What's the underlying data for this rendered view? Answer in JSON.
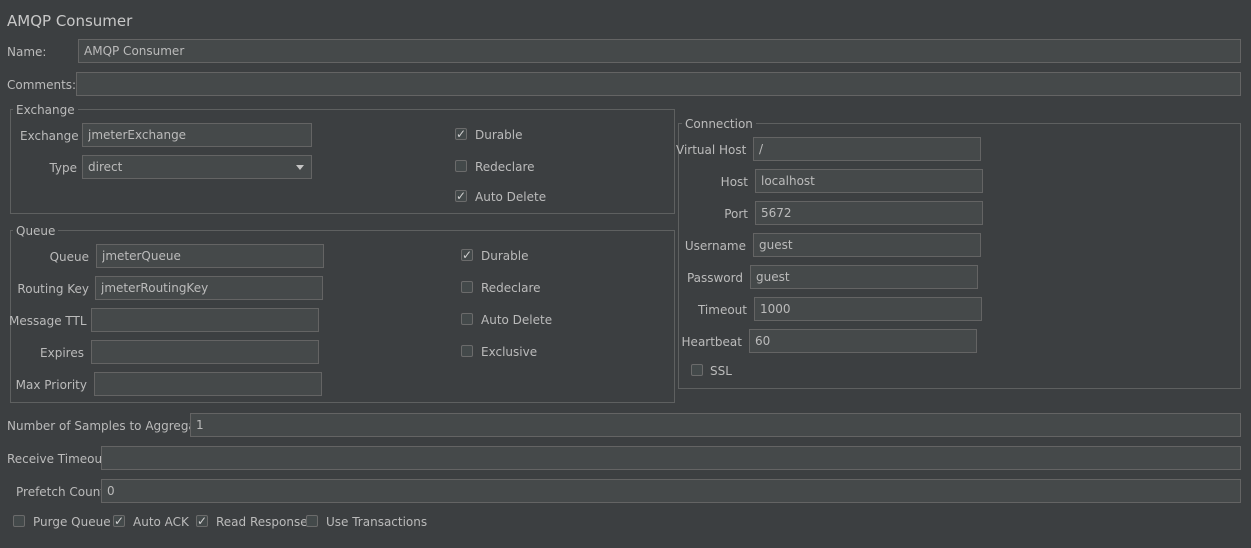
{
  "header": {
    "title": "AMQP Consumer"
  },
  "name": {
    "label": "Name:",
    "value": "AMQP Consumer"
  },
  "comments": {
    "label": "Comments:",
    "value": ""
  },
  "exchange": {
    "legend": "Exchange",
    "exchange_label": "Exchange",
    "exchange_value": "jmeterExchange",
    "type_label": "Type",
    "type_value": "direct",
    "durable_label": "Durable",
    "durable_checked": true,
    "redeclare_label": "Redeclare",
    "redeclare_checked": false,
    "auto_delete_label": "Auto Delete",
    "auto_delete_checked": true
  },
  "queue": {
    "legend": "Queue",
    "queue_label": "Queue",
    "queue_value": "jmeterQueue",
    "routing_key_label": "Routing Key",
    "routing_key_value": "jmeterRoutingKey",
    "message_ttl_label": "Message TTL",
    "message_ttl_value": "",
    "expires_label": "Expires",
    "expires_value": "",
    "max_priority_label": "Max Priority",
    "max_priority_value": "",
    "durable_label": "Durable",
    "durable_checked": true,
    "redeclare_label": "Redeclare",
    "redeclare_checked": false,
    "auto_delete_label": "Auto Delete",
    "auto_delete_checked": false,
    "exclusive_label": "Exclusive",
    "exclusive_checked": false
  },
  "connection": {
    "legend": "Connection",
    "virtual_host_label": "Virtual Host",
    "virtual_host_value": "/",
    "host_label": "Host",
    "host_value": "localhost",
    "port_label": "Port",
    "port_value": "5672",
    "username_label": "Username",
    "username_value": "guest",
    "password_label": "Password",
    "password_value": "guest",
    "timeout_label": "Timeout",
    "timeout_value": "1000",
    "heartbeat_label": "Heartbeat",
    "heartbeat_value": "60",
    "ssl_label": "SSL",
    "ssl_checked": false
  },
  "samples": {
    "label": "Number of Samples to Aggregate",
    "value": "1"
  },
  "receive_timeout": {
    "label": "Receive Timeout",
    "value": ""
  },
  "prefetch_count": {
    "label": "Prefetch Count",
    "value": "0"
  },
  "options": {
    "purge_queue_label": "Purge Queue",
    "purge_queue_checked": false,
    "auto_ack_label": "Auto ACK",
    "auto_ack_checked": true,
    "read_response_label": "Read Response",
    "read_response_checked": true,
    "use_transactions_label": "Use Transactions",
    "use_transactions_checked": false
  },
  "glyphs": {
    "check": "✓"
  },
  "colors": {
    "background": "#3c3f41",
    "field_background": "#45494a",
    "border": "#646464",
    "text": "#bbbbbb"
  }
}
